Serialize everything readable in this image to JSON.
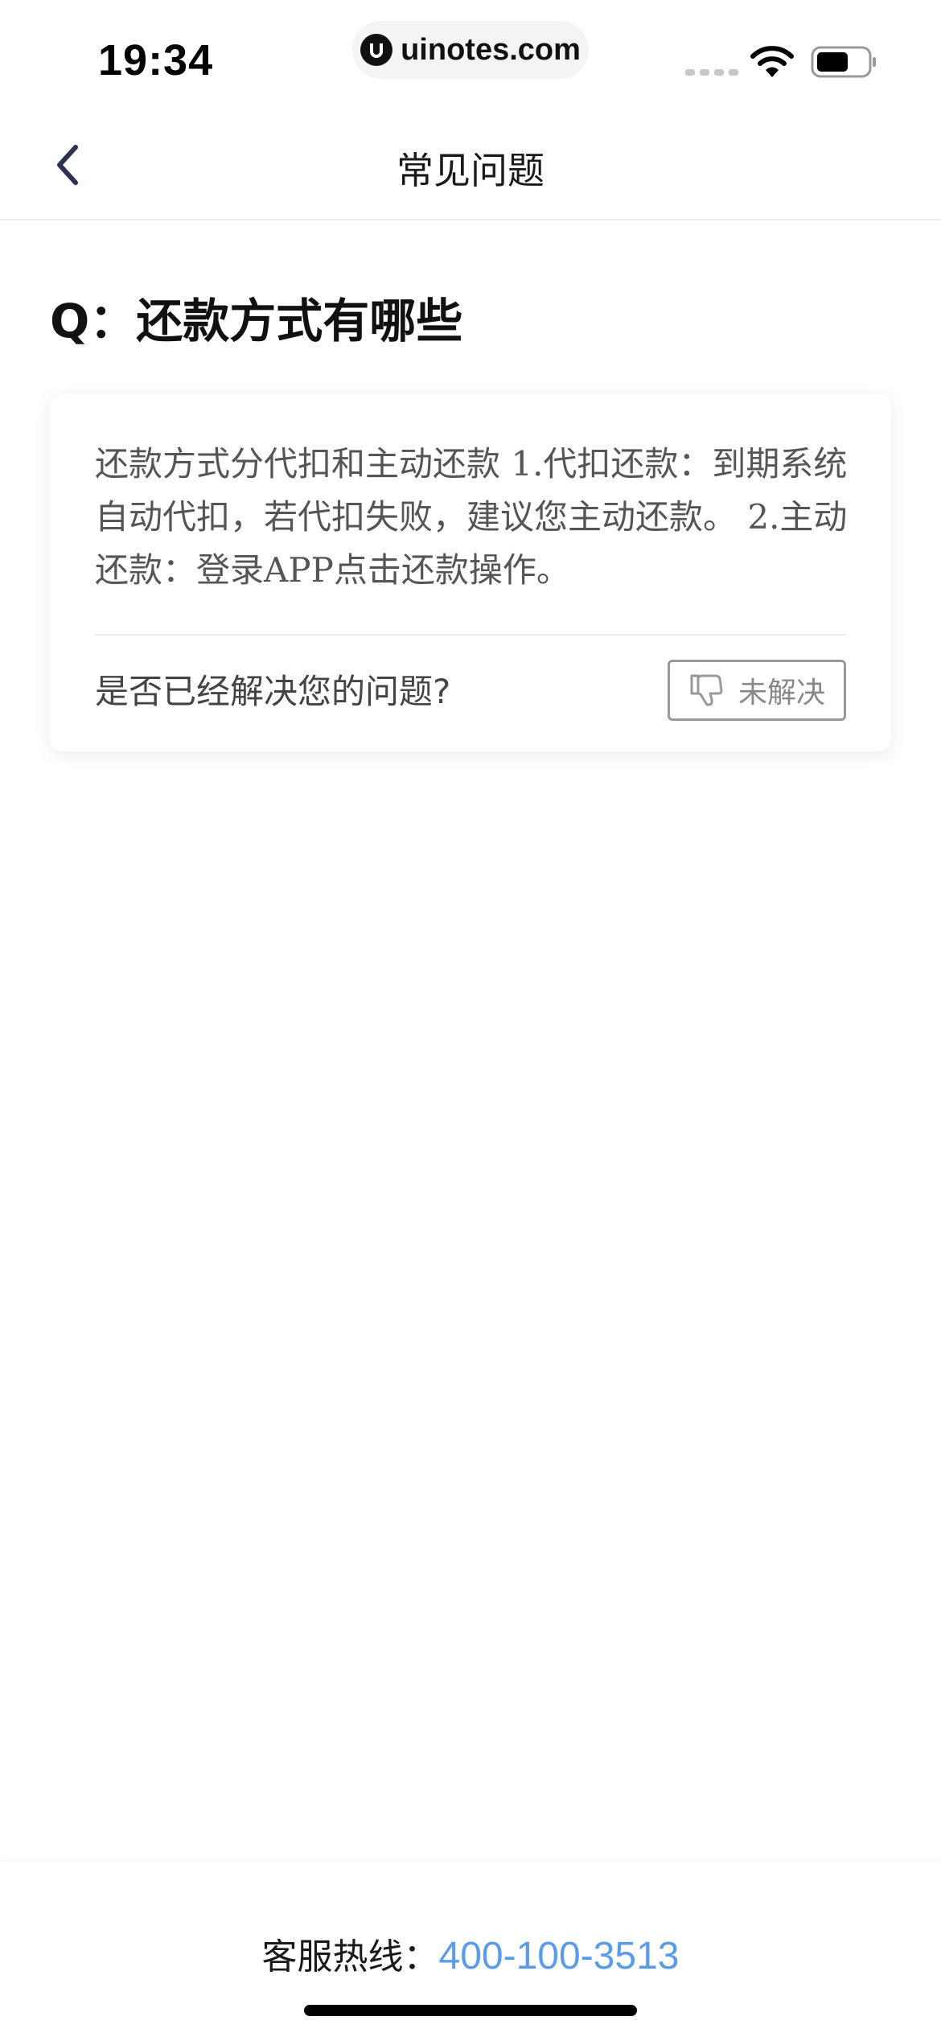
{
  "status_bar": {
    "time": "19:34",
    "url": "uinotes.com"
  },
  "nav": {
    "title": "常见问题"
  },
  "question": {
    "title": "Q：还款方式有哪些"
  },
  "answer": {
    "text": "还款方式分代扣和主动还款 1.代扣还款：到期系统自动代扣，若代扣失败，建议您主动还款。 2.主动还款：登录APP点击还款操作。",
    "feedback_question": "是否已经解决您的问题?",
    "unsolved_label": "未解决"
  },
  "footer": {
    "hotline_label": "客服热线：",
    "hotline_number": "400-100-3513"
  },
  "colors": {
    "accent": "#5b9be8",
    "background": "#ffffff",
    "nav_icon": "#2b3350"
  },
  "icons": {
    "back": "chevron-left-icon",
    "unsolved": "thumbs-down-icon",
    "wifi": "wifi-icon",
    "battery": "battery-icon"
  }
}
